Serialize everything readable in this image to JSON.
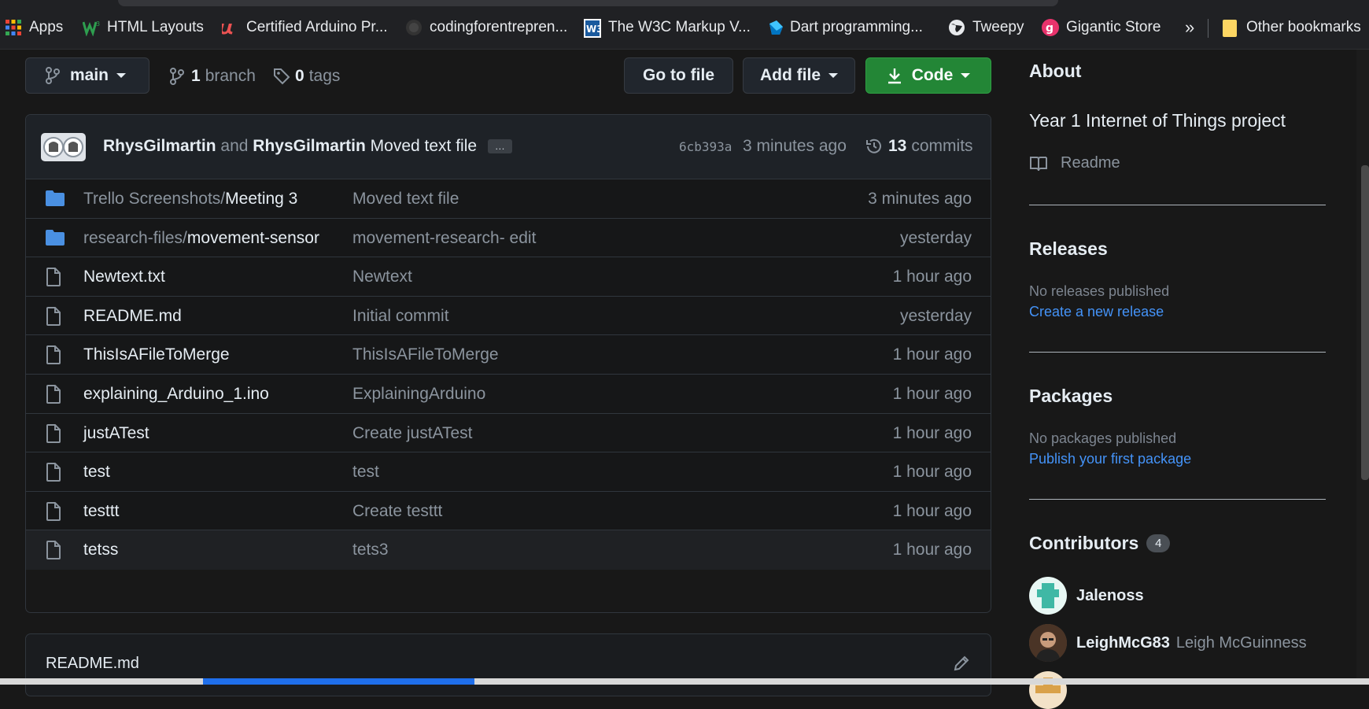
{
  "browser": {
    "bookmarks": [
      {
        "label": "Apps",
        "icon": "apps-grid-icon"
      },
      {
        "label": "HTML Layouts",
        "icon": "w3-logo-icon"
      },
      {
        "label": "Certified Arduino Pr...",
        "icon": "udemy-logo-icon"
      },
      {
        "label": "codingforentrepren...",
        "icon": "github-logo-icon"
      },
      {
        "label": "The W3C Markup V...",
        "icon": "w3c-logo-icon"
      },
      {
        "label": "Dart programming...",
        "icon": "dart-logo-icon"
      },
      {
        "label": "Tweepy",
        "icon": "globe-icon"
      },
      {
        "label": "Gigantic Store",
        "icon": "gigantic-logo-icon"
      }
    ],
    "overflow_label": "»",
    "other_bookmarks": "Other bookmarks"
  },
  "repo": {
    "branch": "main",
    "branch_count": "1",
    "branch_word": "branch",
    "tag_count": "0",
    "tag_word": "tags",
    "go_to_file": "Go to file",
    "add_file": "Add file",
    "code": "Code"
  },
  "commit": {
    "author": "RhysGilmartin",
    "conj": "and",
    "coauthor": "RhysGilmartin",
    "message": "Moved text file",
    "ellipsis": "…",
    "sha": "6cb393a",
    "time": "3 minutes ago",
    "commit_count": "13",
    "commit_word": "commits"
  },
  "files": [
    {
      "type": "folder",
      "prefix": "Trello Screenshots/",
      "name": "Meeting 3",
      "message": "Moved text file",
      "time": "3 minutes ago"
    },
    {
      "type": "folder",
      "prefix": "research-files/",
      "name": "movement-sensor",
      "message": "movement-research- edit",
      "time": "yesterday"
    },
    {
      "type": "file",
      "prefix": "",
      "name": "Newtext.txt",
      "message": "Newtext",
      "time": "1 hour ago"
    },
    {
      "type": "file",
      "prefix": "",
      "name": "README.md",
      "message": "Initial commit",
      "time": "yesterday"
    },
    {
      "type": "file",
      "prefix": "",
      "name": "ThisIsAFileToMerge",
      "message": "ThisIsAFileToMerge",
      "time": "1 hour ago"
    },
    {
      "type": "file",
      "prefix": "",
      "name": "explaining_Arduino_1.ino",
      "message": "ExplainingArduino",
      "time": "1 hour ago"
    },
    {
      "type": "file",
      "prefix": "",
      "name": "justATest",
      "message": "Create justATest",
      "time": "1 hour ago"
    },
    {
      "type": "file",
      "prefix": "",
      "name": "test",
      "message": "test",
      "time": "1 hour ago"
    },
    {
      "type": "file",
      "prefix": "",
      "name": "testtt",
      "message": "Create testtt",
      "time": "1 hour ago"
    },
    {
      "type": "file",
      "prefix": "",
      "name": "tetss",
      "message": "tets3",
      "time": "1 hour ago"
    }
  ],
  "readme": {
    "title": "README.md"
  },
  "sidebar": {
    "about_title": "About",
    "description": "Year 1 Internet of Things project",
    "readme_label": "Readme",
    "releases_title": "Releases",
    "releases_none": "No releases published",
    "releases_link": "Create a new release",
    "packages_title": "Packages",
    "packages_none": "No packages published",
    "packages_link": "Publish your first package",
    "contributors_title": "Contributors",
    "contributors_count": "4",
    "contributors": [
      {
        "login": "Jalenoss",
        "name": ""
      },
      {
        "login": "LeighMcG83",
        "name": "Leigh McGuinness"
      }
    ]
  },
  "colors": {
    "accent_link": "#4493f8",
    "code_button": "#238636",
    "folder_icon": "#4a90e2"
  }
}
